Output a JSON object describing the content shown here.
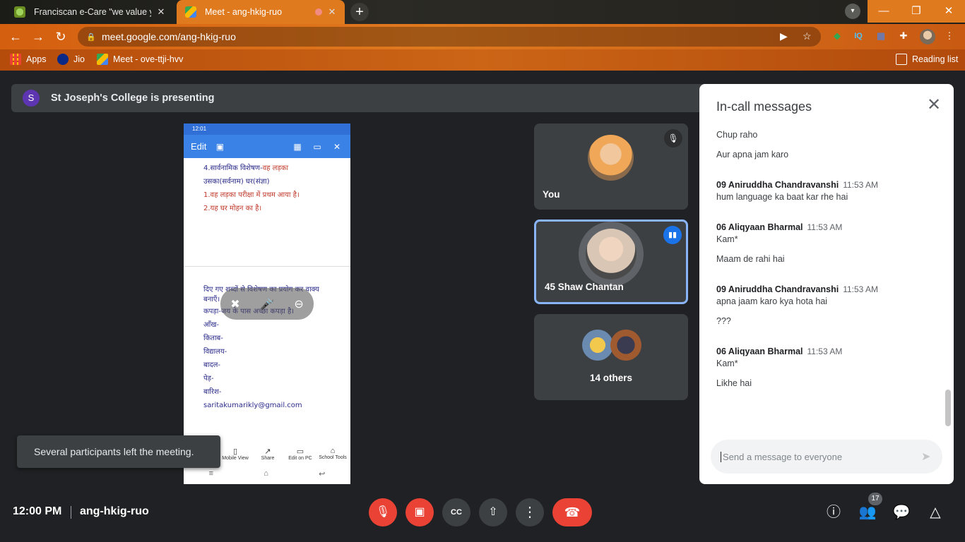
{
  "tabs": [
    {
      "title": "Franciscan e-Care \"we value your",
      "close": "✕"
    },
    {
      "title": "Meet - ang-hkig-ruo",
      "close": "✕"
    }
  ],
  "window": {
    "minimize": "—",
    "maximize": "❐",
    "close": "✕"
  },
  "toolbar": {
    "url": "meet.google.com/ang-hkig-ruo"
  },
  "bookmarks": [
    {
      "label": "Apps"
    },
    {
      "label": "Jio"
    },
    {
      "label": "Meet - ove-ttji-hvv"
    }
  ],
  "reading_list": "Reading list",
  "presenting": {
    "avatar_letter": "S",
    "text": "St Joseph's College is presenting"
  },
  "phone": {
    "status": "12:01",
    "edit_label": "Edit",
    "doc_top": [
      {
        "text": "4.सार्वनामिक विशेषण-",
        "red": "वह लड़का"
      },
      {
        "text": "उसका(सर्वनाम)           घर(संज्ञा)",
        "red": ""
      },
      {
        "text": "",
        "red": "1.वह लड़का परीक्षा में प्रथम आया है।"
      },
      {
        "text": "",
        "red": "2.यह घर मोहन का है।"
      }
    ],
    "doc_bottom": [
      "दिए गए शब्दों से विशेषण का प्रयोग कर वाक्य",
      "बनाएँ।",
      "कपड़ा-जय के पास अच्छा कपड़ा है।",
      "आँख-",
      "किताब-",
      "विद्यालय-",
      "बादल-",
      " पेड़-",
      "बारिश-",
      "saritakumarikly@gmail.com"
    ],
    "bottom_buttons": [
      "Mobile View",
      "Share",
      "Edit on PC",
      "School Tools"
    ]
  },
  "toast": "Several participants left the meeting.",
  "participants": {
    "you": "You",
    "speaker": "45 Shaw Chantan",
    "others": "14 others"
  },
  "chat": {
    "title": "In-call messages",
    "messages": [
      {
        "sender": "",
        "time": "",
        "lines": [
          "Chup raho",
          "Aur apna jam karo"
        ]
      },
      {
        "sender": "09 Aniruddha Chandravanshi",
        "time": "11:53 AM",
        "lines": [
          "hum language ka baat kar rhe hai"
        ]
      },
      {
        "sender": "06 Aliqyaan Bharmal",
        "time": "11:53 AM",
        "lines": [
          "Kam*",
          "Maam de rahi hai"
        ]
      },
      {
        "sender": "09 Aniruddha Chandravanshi",
        "time": "11:53 AM",
        "lines": [
          "apna jaam karo kya hota hai",
          "???"
        ]
      },
      {
        "sender": "06 Aliqyaan Bharmal",
        "time": "11:53 AM",
        "lines": [
          "Kam*",
          "Likhe  hai"
        ]
      }
    ],
    "input_placeholder": "Send a message to everyone"
  },
  "bottom": {
    "time": "12:00 PM",
    "meeting_code": "ang-hkig-ruo",
    "participant_count": "17"
  },
  "colors": {
    "accent": "#1a73e8",
    "danger": "#ea4335",
    "chrome_theme": "#e07a1f"
  }
}
